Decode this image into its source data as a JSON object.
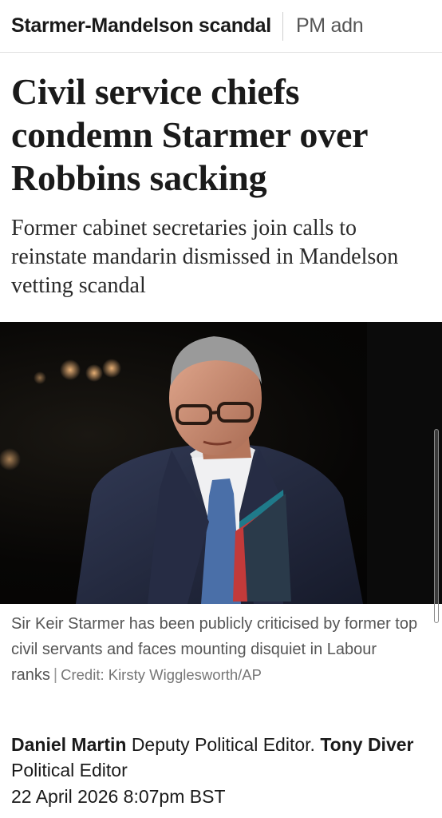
{
  "topics": {
    "active": "Starmer-Mandelson scandal",
    "next": "PM adn"
  },
  "article": {
    "headline": "Civil service chiefs condemn Starmer over Robbins sacking",
    "standfirst": "Former cabinet secretaries join calls to reinstate mandarin dismissed in Mandelson vetting scandal",
    "caption": "Sir Keir Starmer has been publicly criticised by former top civil servants and faces mounting disquiet in Labour ranks",
    "credit": "Credit: Kirsty Wigglesworth/AP",
    "authors": [
      {
        "name": "Daniel Martin",
        "role": "Deputy Political Editor."
      },
      {
        "name": "Tony Diver",
        "role": "Political Editor"
      }
    ],
    "date": "22 April 2026 8:07pm BST"
  },
  "colors": {
    "text": "#1a1a1a",
    "caption": "#555555",
    "photo_background": "#050505",
    "tie": "#4a6fa8"
  },
  "icons": [
    "scrollbar-handle"
  ]
}
